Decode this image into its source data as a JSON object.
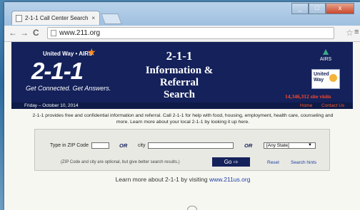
{
  "browser": {
    "tab_title": "2-1-1 Call Center Search",
    "tab_close": "×",
    "url": "www.211.org",
    "win_min": "_",
    "win_max": "□",
    "win_close": "x",
    "back": "←",
    "forward": "→",
    "reload": "C",
    "bookmark": "☆",
    "menu": "≡"
  },
  "banner": {
    "logo_top": "United Way • AIRS",
    "logo_star": "★",
    "logo_number": "2-1-1",
    "logo_tagline": "Get Connected. Get Answers.",
    "title_line1": "2-1-1",
    "title_line2": "Information & Referral",
    "title_line3": "Search",
    "airs_label": "AIRS",
    "airs_mark": "▲",
    "uw_line1": "United",
    "uw_line2": "Way",
    "visits": "14,346,312 site visits"
  },
  "datebar": {
    "date": "Friday – October 10, 2014",
    "home": "Home",
    "contact": "Contact Us"
  },
  "intro": "2-1-1 provides free and confidential information and referral. Call 2-1-1 for help with food, housing, employment, health care, counseling and more.  Learn more about your local 2-1-1 by looking it up here.",
  "search": {
    "zip_label": "Type in ZIP Code",
    "zip_value": "",
    "or1": "OR",
    "city_label": "city",
    "city_value": "",
    "or2": "OR",
    "state_selected": "[Any State]",
    "state_arrow": "▼",
    "note": "(ZIP Code and city are optional, but give better search results.)",
    "go_label": "Go  ⇨",
    "reset": "Reset",
    "hints": "Search hints"
  },
  "learn": {
    "text": "Learn more about 2-1-1 by visiting ",
    "link": "www.211us.org"
  },
  "colors": {
    "banner_navy": "#14215a",
    "visits_red": "#ff4a2a",
    "link_blue": "#1c3fa0"
  }
}
